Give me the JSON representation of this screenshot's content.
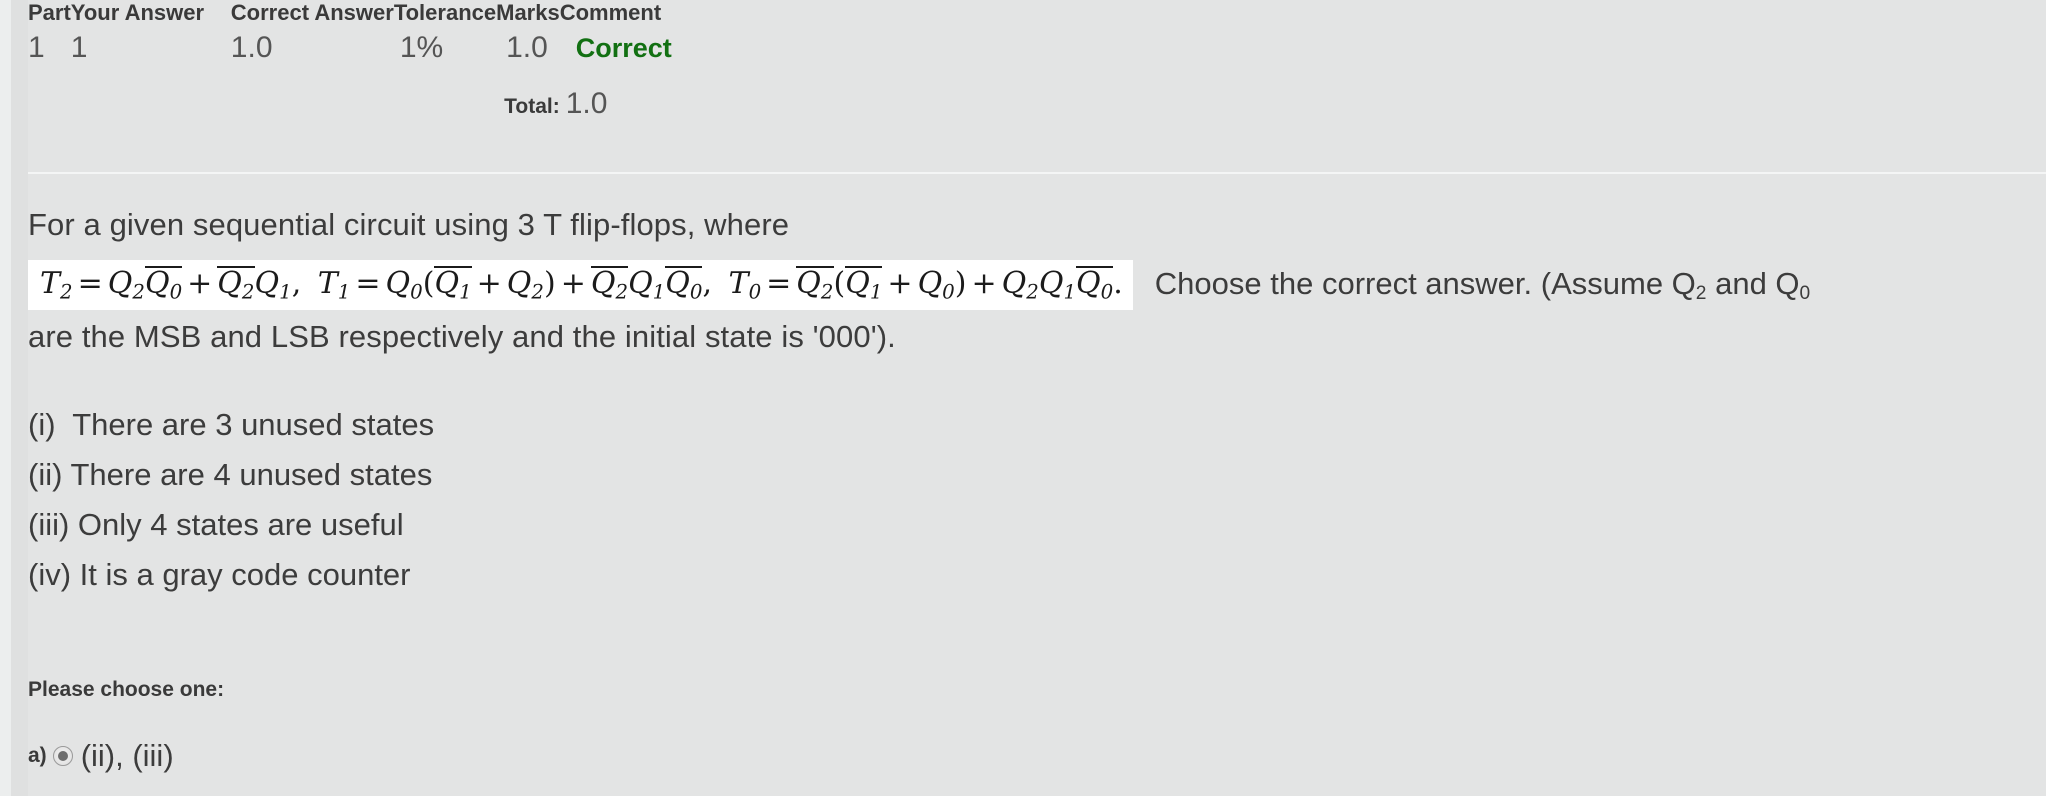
{
  "grading": {
    "headers": [
      "Part",
      "Your Answer",
      "Correct Answer",
      "Tolerance",
      "Marks",
      "Comment"
    ],
    "rows": [
      {
        "part": "1",
        "your_answer": "1",
        "correct_answer": "1.0",
        "tolerance": "1%",
        "marks": "1.0",
        "comment": "Correct"
      }
    ],
    "total_label": "Total:",
    "total_value": "1.0",
    "correct_color": "#127012"
  },
  "question": {
    "intro": "For a given sequential circuit using 3 T flip-flops, where",
    "formula_plain": "T2 = Q2·Q0' + Q2'·Q1,  T1 = Q0(Q1' + Q2) + Q2'Q1Q0',  T0 = Q2'(Q1' + Q0) + Q2Q1Q0'.",
    "formula_terms": {
      "t2_lhs": "T",
      "t2_sub": "2",
      "t1_lhs": "T",
      "t1_sub": "1",
      "t0_lhs": "T",
      "t0_sub": "0",
      "q": "Q",
      "eq": "=",
      "plus": "+",
      "comma": ",",
      "period": ".",
      "open_paren": "(",
      "close_paren": ")"
    },
    "tail_before_sub1": "Choose the correct answer. (Assume Q",
    "tail_sub1": "2",
    "tail_middle": " and Q",
    "tail_sub2": "0",
    "line2": "are the MSB and LSB respectively and the initial state is '000').",
    "options": [
      "(i)  There are 3 unused states",
      "(ii) There are 4 unused states",
      "(iii) Only 4 states are useful",
      "(iv) It is a gray code counter"
    ]
  },
  "answer": {
    "prompt": "Please choose one:",
    "letter": "a)",
    "selected_text": "(ii), (iii)",
    "selected": true
  }
}
